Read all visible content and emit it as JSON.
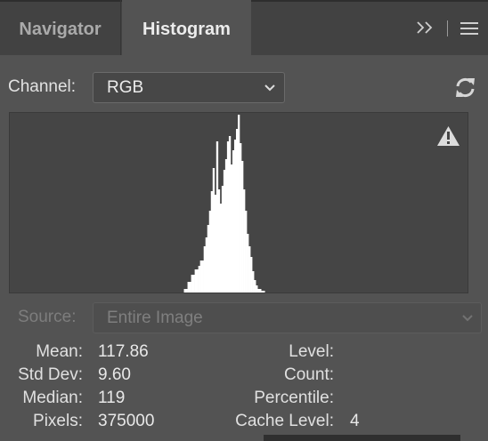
{
  "tabs": {
    "navigator_label": "Navigator",
    "histogram_label": "Histogram",
    "active": "Histogram"
  },
  "channel": {
    "label": "Channel:",
    "value": "RGB"
  },
  "source": {
    "label": "Source:",
    "value": "Entire Image",
    "enabled": false
  },
  "stats": {
    "mean_label": "Mean:",
    "mean_value": "117.86",
    "std_dev_label": "Std Dev:",
    "std_dev_value": "9.60",
    "median_label": "Median:",
    "median_value": "119",
    "pixels_label": "Pixels:",
    "pixels_value": "375000",
    "level_label": "Level:",
    "level_value": "",
    "count_label": "Count:",
    "count_value": "",
    "percentile_label": "Percentile:",
    "percentile_value": "",
    "cache_level_label": "Cache Level:",
    "cache_level_value": "4"
  },
  "icons": {
    "collapse": "double-chevron-right-icon",
    "menu": "hamburger-menu-icon",
    "refresh": "refresh-icon",
    "warning": "warning-icon",
    "dropdown": "chevron-down-icon"
  },
  "colors": {
    "panel_background": "#535353",
    "tab_bar_background": "#424242",
    "histogram_background": "#454545",
    "histogram_fill": "#ffffff"
  },
  "chart_data": {
    "type": "area",
    "channel": "RGB",
    "x_range": [
      0,
      255
    ],
    "x": [
      97,
      99,
      101,
      103,
      105,
      106,
      108,
      109,
      110,
      111,
      112,
      113,
      114,
      115,
      116,
      117,
      118,
      119,
      120,
      121,
      122,
      123,
      124,
      125,
      126,
      127,
      128,
      129,
      130,
      131,
      132,
      133,
      134,
      135,
      136,
      137,
      138,
      140,
      142
    ],
    "values": [
      0.02,
      0.06,
      0.1,
      0.13,
      0.15,
      0.18,
      0.26,
      0.31,
      0.38,
      0.46,
      0.57,
      0.7,
      0.55,
      0.85,
      0.58,
      0.5,
      0.6,
      0.69,
      0.75,
      0.85,
      0.88,
      0.72,
      0.8,
      0.86,
      0.92,
      1.0,
      0.84,
      0.74,
      0.58,
      0.46,
      0.33,
      0.26,
      0.2,
      0.12,
      0.07,
      0.04,
      0.02,
      0.01,
      0.0
    ]
  }
}
